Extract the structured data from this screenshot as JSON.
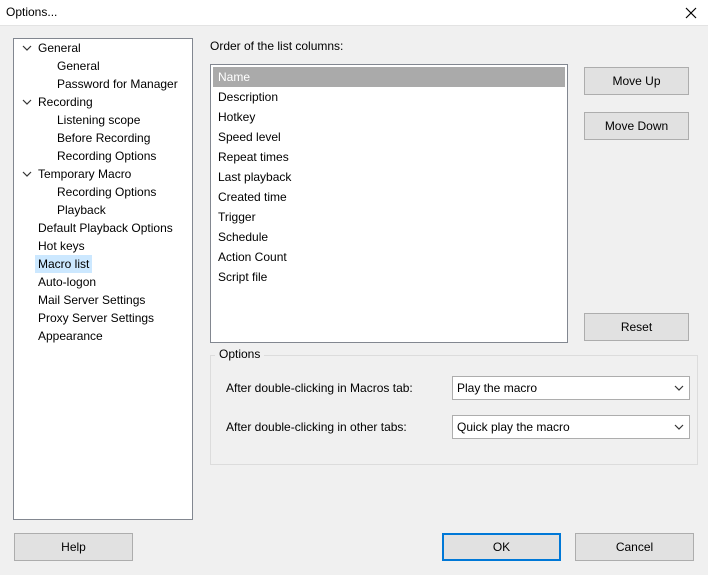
{
  "window": {
    "title": "Options..."
  },
  "tree": {
    "items": [
      {
        "label": "General"
      },
      {
        "label": "General"
      },
      {
        "label": "Password for Manager"
      },
      {
        "label": "Recording"
      },
      {
        "label": "Listening scope"
      },
      {
        "label": "Before Recording"
      },
      {
        "label": "Recording Options"
      },
      {
        "label": "Temporary Macro"
      },
      {
        "label": "Recording Options"
      },
      {
        "label": "Playback"
      },
      {
        "label": "Default Playback Options"
      },
      {
        "label": "Hot keys"
      },
      {
        "label": "Macro list",
        "selected": true
      },
      {
        "label": "Auto-logon"
      },
      {
        "label": "Mail Server Settings"
      },
      {
        "label": "Proxy Server Settings"
      },
      {
        "label": "Appearance"
      }
    ]
  },
  "main": {
    "order_label": "Order of the list columns:",
    "columns": [
      {
        "label": "Name",
        "selected": true
      },
      {
        "label": "Description"
      },
      {
        "label": "Hotkey"
      },
      {
        "label": "Speed level"
      },
      {
        "label": "Repeat times"
      },
      {
        "label": "Last playback"
      },
      {
        "label": "Created time"
      },
      {
        "label": "Trigger"
      },
      {
        "label": "Schedule"
      },
      {
        "label": "Action Count"
      },
      {
        "label": "Script file"
      }
    ],
    "move_up_label": "Move Up",
    "move_down_label": "Move Down",
    "reset_label": "Reset",
    "options": {
      "title": "Options",
      "macros_tab_label": "After double-clicking in Macros tab:",
      "macros_tab_value": "Play the macro",
      "other_tabs_label": "After double-clicking in other tabs:",
      "other_tabs_value": "Quick play the macro"
    }
  },
  "footer": {
    "help_label": "Help",
    "ok_label": "OK",
    "cancel_label": "Cancel"
  },
  "colors": {
    "selection_tree": "#cce8ff",
    "selection_list": "#aaaaaa",
    "default_button_border": "#0078d7"
  }
}
